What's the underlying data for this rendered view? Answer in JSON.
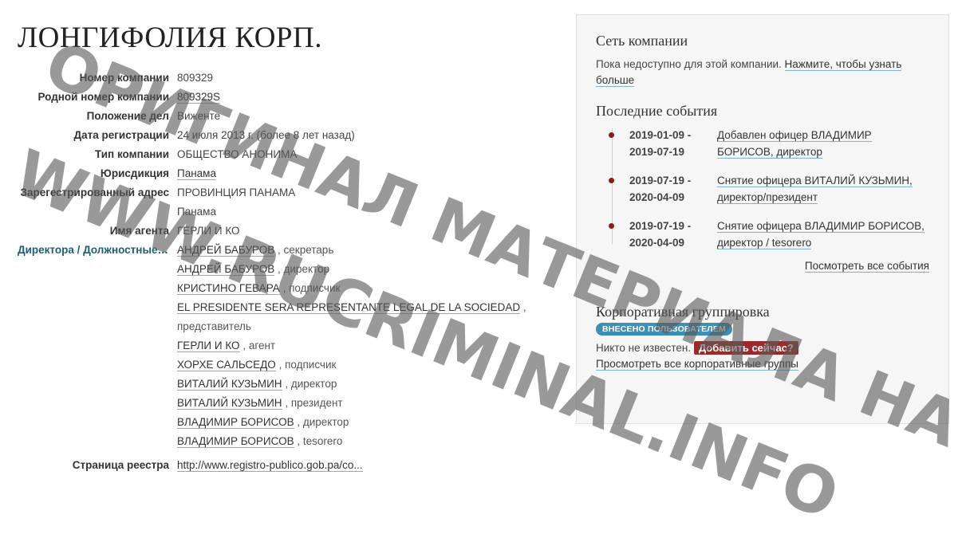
{
  "company": {
    "title": "ЛОНГИФОЛИЯ КОРП.",
    "fields": {
      "company_number_label": "Номер компании",
      "company_number": "809329",
      "native_number_label": "Родной номер компании",
      "native_number": "809329S",
      "status_label": "Положение дел",
      "status": "Виженте",
      "incorporation_label": "Дата регистрации",
      "incorporation": "24 июля 2013 г. (более 8 лет назад)",
      "type_label": "Тип компании",
      "type": "ОБЩЕСТВО АНОНИМА",
      "jurisdiction_label": "Юрисдикция",
      "jurisdiction": "Панама",
      "address_label": "Зарегестрированный адрес",
      "address_line1": "ПРОВИНЦИЯ ПАНАМА",
      "address_line2": "Панама",
      "agent_label": "Имя агента",
      "agent": "ГЕРЛИ И КО",
      "officers_label": "Директора / Должностные ...",
      "registry_label": "Страница реестра",
      "registry_url": "http://www.registro-publico.gob.pa/co..."
    },
    "officers": [
      {
        "name": "АНДРЕЙ БАБУРОВ",
        "role": ", секретарь"
      },
      {
        "name": "АНДРЕЙ БАБУРОВ",
        "role": ", директор"
      },
      {
        "name": "КРИСТИНО ГЕВАРА",
        "role": ", подписчик"
      },
      {
        "name": "EL PRESIDENTE SERA REPRESENTANTE LEGAL DE LA SOCIEDAD",
        "role": ",",
        "role_line2": "представитель"
      },
      {
        "name": "ГЕРЛИ И КО",
        "role": ", агент"
      },
      {
        "name": "ХОРХЕ САЛЬСЕДО",
        "role": ", подписчик"
      },
      {
        "name": "ВИТАЛИЙ КУЗЬМИН",
        "role": ", директор"
      },
      {
        "name": "ВИТАЛИЙ КУЗЬМИН",
        "role": ", президент"
      },
      {
        "name": "ВЛАДИМИР БОРИСОВ",
        "role": ", директор"
      },
      {
        "name": "ВЛАДИМИР БОРИСОВ",
        "role": ", tesorero"
      }
    ]
  },
  "sidebar": {
    "network_title": "Сеть компании",
    "network_text": "Пока недоступно для этой компании.",
    "network_link": "Нажмите, чтобы узнать больше",
    "events_title": "Последние события",
    "events": [
      {
        "date1": "2019-01-09 -",
        "date2": "2019-07-19",
        "desc": "Добавлен офицер ВЛАДИМИР БОРИСОВ, директор"
      },
      {
        "date1": "2019-07-19 -",
        "date2": "2020-04-09",
        "desc": "Снятие офицера ВИТАЛИЙ КУЗЬМИН, директор/президент"
      },
      {
        "date1": "2019-07-19 -",
        "date2": "2020-04-09",
        "desc": "Снятие офицера ВЛАДИМИР БОРИСОВ, директор / tesorero"
      }
    ],
    "all_events_link": "Посмотреть все события",
    "grouping_title": "Корпоративная группировка",
    "grouping_badge": "ВНЕСЕНО ПОЛЬЗОВАТЕЛЕМ",
    "grouping_none": "Никто не известен.",
    "grouping_add": "Добавить сейчас?",
    "grouping_all_link": "Просмотреть все корпоративные группы"
  },
  "watermark": {
    "line1": "ОРИГИНАЛ МАТЕРИАЛА НА",
    "line2": "WWW.RUCRIMINAL.INFO"
  },
  "colors": {
    "link_underline": "#7fb3c9",
    "badge": "#3d8fb5",
    "add_button": "#9b2a2a",
    "event_dot": "#8b1c1c"
  }
}
